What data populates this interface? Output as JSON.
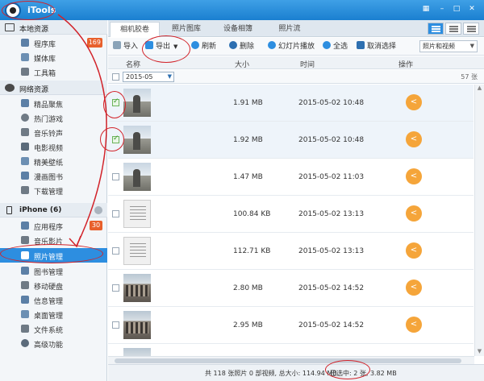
{
  "app": {
    "title": "iTools"
  },
  "sidebar": {
    "sections": [
      {
        "label": "本地资源",
        "items": [
          {
            "label": "程序库",
            "badge": "169"
          },
          {
            "label": "媒体库"
          },
          {
            "label": "工具箱"
          }
        ]
      },
      {
        "label": "网络资源",
        "items": [
          {
            "label": "精品聚焦"
          },
          {
            "label": "热门游戏"
          },
          {
            "label": "音乐铃声"
          },
          {
            "label": "电影视频"
          },
          {
            "label": "精美壁纸"
          },
          {
            "label": "漫画图书"
          },
          {
            "label": "下载管理"
          }
        ]
      },
      {
        "label": "iPhone (6)",
        "items": [
          {
            "label": "应用程序",
            "badge": "30"
          },
          {
            "label": "音乐影片"
          },
          {
            "label": "照片管理",
            "active": true
          },
          {
            "label": "图书管理"
          },
          {
            "label": "移动硬盘"
          },
          {
            "label": "信息管理"
          },
          {
            "label": "桌面管理"
          },
          {
            "label": "文件系统"
          },
          {
            "label": "高级功能"
          }
        ]
      }
    ]
  },
  "tabs": [
    "相机胶卷",
    "照片图库",
    "设备相簿",
    "照片流"
  ],
  "toolbar": {
    "import": "导入",
    "export": "导出",
    "refresh": "刷新",
    "delete": "删除",
    "slideshow": "幻灯片播放",
    "select_all": "全选",
    "deselect": "取消选择",
    "view_select": "照片和视频"
  },
  "columns": {
    "name": "名称",
    "size": "大小",
    "time": "时间",
    "action": "操作"
  },
  "group": {
    "month": "2015-05",
    "count": "57 张"
  },
  "rows": [
    {
      "checked": true,
      "size": "1.91 MB",
      "time": "2015-05-02 10:48",
      "thumb": "tower"
    },
    {
      "checked": true,
      "size": "1.92 MB",
      "time": "2015-05-02 10:48",
      "thumb": "tower"
    },
    {
      "checked": false,
      "size": "1.47 MB",
      "time": "2015-05-02 11:03",
      "thumb": "tower"
    },
    {
      "checked": false,
      "size": "100.84 KB",
      "time": "2015-05-02 13:13",
      "thumb": "doc"
    },
    {
      "checked": false,
      "size": "112.71 KB",
      "time": "2015-05-02 13:13",
      "thumb": "doc"
    },
    {
      "checked": false,
      "size": "2.80 MB",
      "time": "2015-05-02 14:52",
      "thumb": "street"
    },
    {
      "checked": false,
      "size": "2.95 MB",
      "time": "2015-05-02 14:52",
      "thumb": "street"
    },
    {
      "checked": false,
      "size": "",
      "time": "",
      "thumb": "street"
    }
  ],
  "status": {
    "summary": "共 118 张照片 0 部视频, 总大小: 114.94 MB",
    "selected": "已选中: 2 张, 3.82 MB"
  },
  "colors": {
    "accent": "#2d8ee0",
    "badge": "#e8602c",
    "share": "#f5a53a",
    "annotation": "#d2232a"
  },
  "icons": [
    "minimize-icon",
    "maximize-icon",
    "close-icon",
    "share-icon"
  ]
}
